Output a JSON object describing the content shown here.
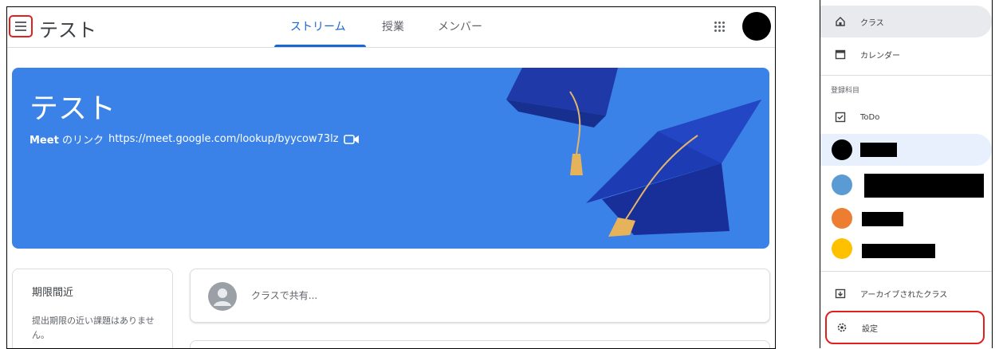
{
  "left": {
    "title": "テスト",
    "tabs": [
      {
        "label": "ストリーム",
        "active": true
      },
      {
        "label": "授業",
        "active": false
      },
      {
        "label": "メンバー",
        "active": false
      }
    ],
    "banner": {
      "title": "テスト",
      "meet_prefix": "Meet",
      "meet_text": "のリンク",
      "meet_url": "https://meet.google.com/lookup/byycow73lz",
      "color": "#3b82e8"
    },
    "upcoming": {
      "heading": "期限間近",
      "empty_text": "提出期限の近い課題はありません。"
    },
    "share_placeholder": "クラスで共有..."
  },
  "drawer": {
    "items_top": [
      {
        "label": "クラス",
        "icon": "home-icon"
      },
      {
        "label": "カレンダー",
        "icon": "calendar-icon"
      }
    ],
    "section_label": "登録科目",
    "todo_label": "ToDo",
    "classes": [
      {
        "color": "#000000"
      },
      {
        "color": "#5b9bd5"
      },
      {
        "color": "#ed7d31"
      },
      {
        "color": "#ffc000"
      }
    ],
    "archived_label": "アーカイブされたクラス",
    "settings_label": "設定"
  }
}
